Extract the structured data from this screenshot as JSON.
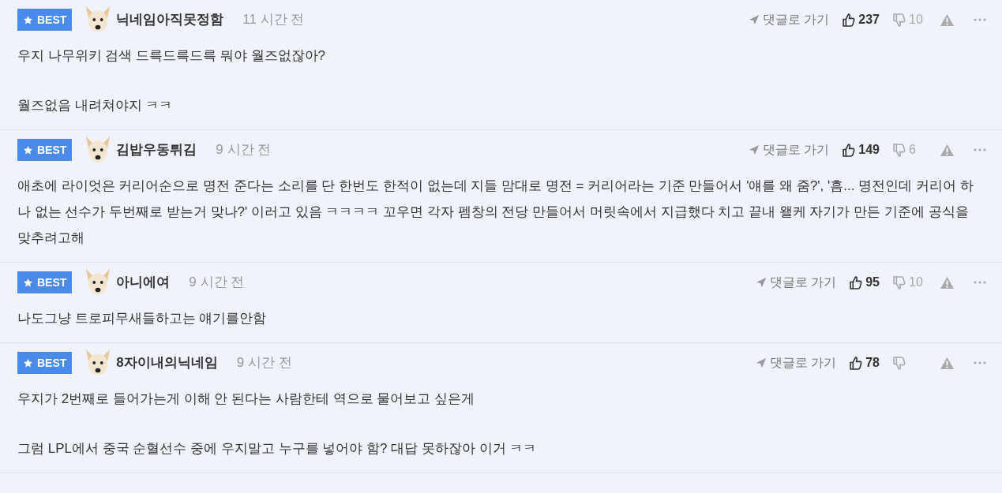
{
  "comments": [
    {
      "badge": "BEST",
      "nickname": "닉네임아직못정함",
      "time": "11 시간 전",
      "goto": "댓글로 가기",
      "likes": "237",
      "dislikes": "10",
      "paragraphs": [
        "우지 나무위키 검색 드륵드륵드륵 뭐야 월즈없잖아?",
        "월즈없음 내려쳐야지 ㅋㅋ"
      ]
    },
    {
      "badge": "BEST",
      "nickname": "김밥우동튀김",
      "time": "9 시간 전",
      "goto": "댓글로 가기",
      "likes": "149",
      "dislikes": "6",
      "paragraphs": [
        "애초에 라이엇은 커리어순으로 명전 준다는 소리를 단 한번도 한적이 없는데 지들 맘대로 명전 = 커리어라는 기준 만들어서 '얘를 왜 줌?', '흠... 명전인데 커리어 하나 없는 선수가 두번째로 받는거 맞나?' 이러고 있음 ㅋㅋㅋㅋ 꼬우면 각자 펨창의 전당 만들어서 머릿속에서 지급했다 치고 끝내 왤케 자기가 만든 기준에 공식을 맞추려고해"
      ]
    },
    {
      "badge": "BEST",
      "nickname": "아니에여",
      "time": "9 시간 전",
      "goto": "댓글로 가기",
      "likes": "95",
      "dislikes": "10",
      "paragraphs": [
        "나도그냥 트로피무새들하고는 얘기를안함"
      ]
    },
    {
      "badge": "BEST",
      "nickname": "8자이내의닉네임",
      "time": "9 시간 전",
      "goto": "댓글로 가기",
      "likes": "78",
      "paragraphs": [
        "우지가 2번째로 들어가는게 이해 안 된다는 사람한테 역으로 물어보고 싶은게",
        "그럼 LPL에서 중국 순혈선수 중에 우지말고 누구를 넣어야 함? 대답 못하잖아 이거 ㅋㅋ"
      ]
    }
  ]
}
